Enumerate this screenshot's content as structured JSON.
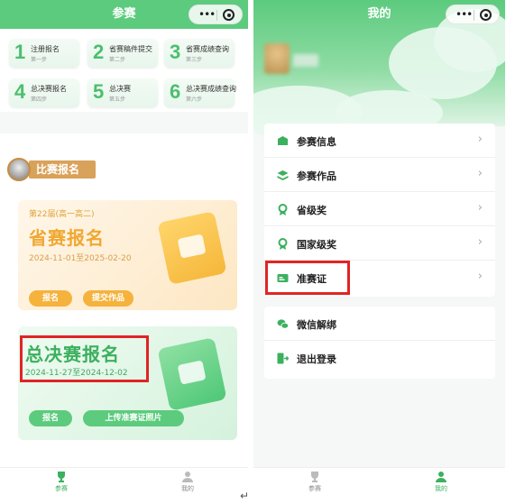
{
  "left": {
    "title": "参赛",
    "steps": [
      {
        "num": "1",
        "label": "注册报名",
        "sub": "第一步"
      },
      {
        "num": "2",
        "label": "省赛稿件提交",
        "sub": "第二步"
      },
      {
        "num": "3",
        "label": "省赛成绩查询",
        "sub": "第三步"
      },
      {
        "num": "4",
        "label": "总决赛报名",
        "sub": "第四步"
      },
      {
        "num": "5",
        "label": "总决赛",
        "sub": "第五步"
      },
      {
        "num": "6",
        "label": "总决赛成绩查询",
        "sub": "第六步"
      }
    ],
    "section_title": "比赛报名",
    "card1": {
      "edition": "第22届(高一高二)",
      "title": "省赛报名",
      "date": "2024-11-01至2025-02-20",
      "btn_signup": "报名",
      "btn_submit": "提交作品"
    },
    "card2": {
      "title": "总决赛报名",
      "date": "2024-11-27至2024-12-02",
      "btn_signup": "报名",
      "btn_upload": "上传准赛证照片"
    },
    "tabs": {
      "contest": "参赛",
      "mine": "我的"
    }
  },
  "right": {
    "title": "我的",
    "menu1": [
      "参赛信息",
      "参赛作品",
      "省级奖",
      "国家级奖",
      "准赛证"
    ],
    "menu2": [
      "微信解绑",
      "退出登录"
    ],
    "tabs": {
      "contest": "参赛",
      "mine": "我的"
    }
  },
  "return_glyph": "↵",
  "colors": {
    "brand_green": "#5ccb7e",
    "accent_orange": "#f5b23d",
    "highlight_red": "#e02424"
  }
}
